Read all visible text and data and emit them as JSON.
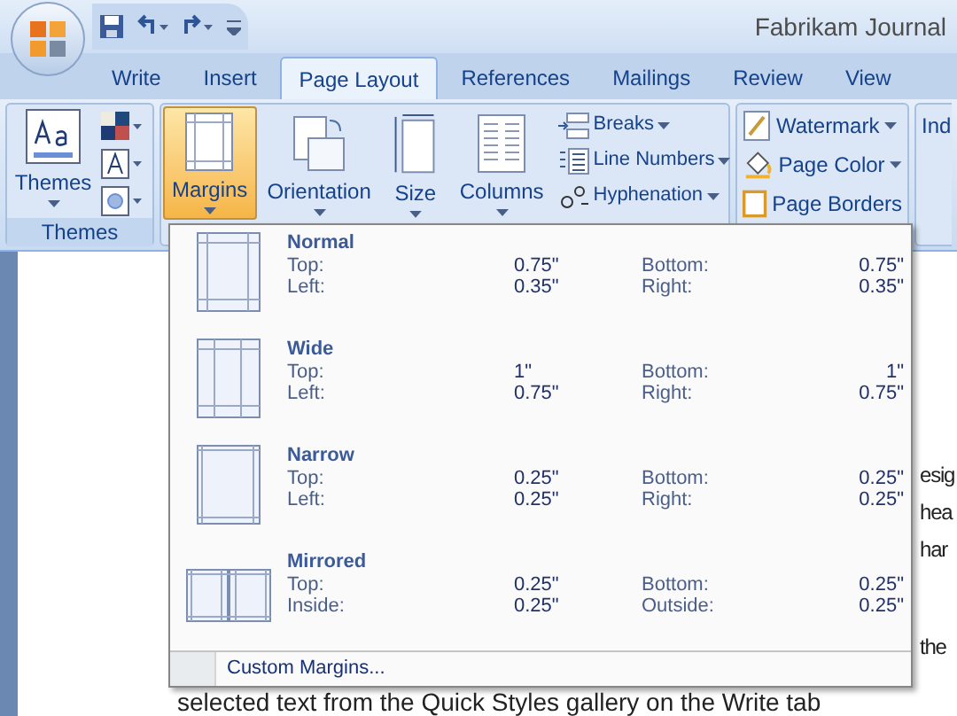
{
  "window": {
    "title": "Fabrikam Journal"
  },
  "tabs": [
    {
      "label": "Write",
      "selected": false
    },
    {
      "label": "Insert",
      "selected": false
    },
    {
      "label": "Page Layout",
      "selected": true
    },
    {
      "label": "References",
      "selected": false
    },
    {
      "label": "Mailings",
      "selected": false
    },
    {
      "label": "Review",
      "selected": false
    },
    {
      "label": "View",
      "selected": false
    }
  ],
  "ribbon": {
    "themes_group": {
      "label": "Themes",
      "button": "Themes"
    },
    "page_setup": {
      "big_buttons": [
        {
          "label": "Margins",
          "kind": "margins",
          "selected": true
        },
        {
          "label": "Orientation",
          "kind": "orientation",
          "selected": false
        },
        {
          "label": "Size",
          "kind": "size",
          "selected": false
        },
        {
          "label": "Columns",
          "kind": "columns",
          "selected": false
        }
      ],
      "small_buttons": [
        {
          "label": "Breaks",
          "kind": "breaks"
        },
        {
          "label": "Line Numbers",
          "kind": "line_numbers"
        },
        {
          "label": "Hyphenation",
          "kind": "hyphenation"
        }
      ]
    },
    "page_background": [
      {
        "label": "Watermark",
        "kind": "watermark"
      },
      {
        "label": "Page Color",
        "kind": "page_color"
      },
      {
        "label": "Page Borders",
        "kind": "page_borders"
      }
    ],
    "next_group_label": "Ind"
  },
  "margins_menu": {
    "items": [
      {
        "name": "Normal",
        "kind": "normal",
        "rows": [
          {
            "left_label": "Top:",
            "left_value": "0.75\"",
            "right_label": "Bottom:",
            "right_value": "0.75\""
          },
          {
            "left_label": "Left:",
            "left_value": "0.35\"",
            "right_label": "Right:",
            "right_value": "0.35\""
          }
        ]
      },
      {
        "name": "Wide",
        "kind": "wide",
        "rows": [
          {
            "left_label": "Top:",
            "left_value": "1\"",
            "right_label": "Bottom:",
            "right_value": "1\""
          },
          {
            "left_label": "Left:",
            "left_value": "0.75\"",
            "right_label": "Right:",
            "right_value": "0.75\""
          }
        ]
      },
      {
        "name": "Narrow",
        "kind": "narrow",
        "rows": [
          {
            "left_label": "Top:",
            "left_value": "0.25\"",
            "right_label": "Bottom:",
            "right_value": "0.25\""
          },
          {
            "left_label": "Left:",
            "left_value": "0.25\"",
            "right_label": "Right:",
            "right_value": "0.25\""
          }
        ]
      },
      {
        "name": "Mirrored",
        "kind": "mirrored",
        "rows": [
          {
            "left_label": "Top:",
            "left_value": "0.25\"",
            "right_label": "Bottom:",
            "right_value": "0.25\""
          },
          {
            "left_label": "Inside:",
            "left_value": "0.25\"",
            "right_label": "Outside:",
            "right_value": "0.25\""
          }
        ]
      }
    ],
    "footer": "Custom Margins..."
  },
  "document": {
    "line_fragments": [
      "esig",
      "hea",
      "har",
      "the"
    ],
    "bottom_line": "selected text from the Quick Styles gallery on the Write tab"
  }
}
